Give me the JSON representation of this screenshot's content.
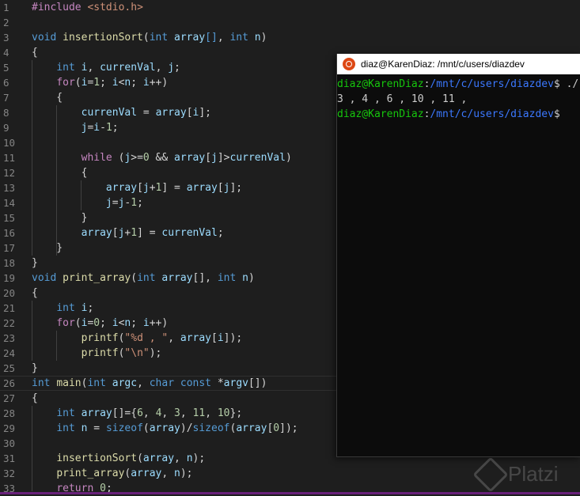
{
  "editor": {
    "lines": [
      {
        "n": "1",
        "segs": [
          [
            "pre",
            "#include"
          ],
          [
            "p",
            " "
          ],
          [
            "str",
            "<stdio.h>"
          ]
        ]
      },
      {
        "n": "2",
        "segs": []
      },
      {
        "n": "3",
        "segs": [
          [
            "kw",
            "void"
          ],
          [
            "p",
            " "
          ],
          [
            "fn",
            "insertionSort"
          ],
          [
            "p",
            "("
          ],
          [
            "kw",
            "int"
          ],
          [
            "p",
            " "
          ],
          [
            "var",
            "array"
          ],
          [
            "kw",
            "[]"
          ],
          [
            "p",
            ", "
          ],
          [
            "kw",
            "int"
          ],
          [
            "p",
            " "
          ],
          [
            "var",
            "n"
          ],
          [
            "p",
            ")"
          ]
        ]
      },
      {
        "n": "4",
        "segs": [
          [
            "p",
            "{"
          ]
        ]
      },
      {
        "n": "5",
        "segs": [
          [
            "p",
            "    "
          ],
          [
            "kw",
            "int"
          ],
          [
            "p",
            " "
          ],
          [
            "var",
            "i"
          ],
          [
            "p",
            ", "
          ],
          [
            "var",
            "currenVal"
          ],
          [
            "p",
            ", "
          ],
          [
            "var",
            "j"
          ],
          [
            "p",
            ";"
          ]
        ]
      },
      {
        "n": "6",
        "segs": [
          [
            "p",
            "    "
          ],
          [
            "ctl",
            "for"
          ],
          [
            "p",
            "("
          ],
          [
            "var",
            "i"
          ],
          [
            "p",
            "="
          ],
          [
            "num",
            "1"
          ],
          [
            "p",
            "; "
          ],
          [
            "var",
            "i"
          ],
          [
            "p",
            "<"
          ],
          [
            "var",
            "n"
          ],
          [
            "p",
            "; "
          ],
          [
            "var",
            "i"
          ],
          [
            "p",
            "++)"
          ]
        ]
      },
      {
        "n": "7",
        "segs": [
          [
            "p",
            "    {"
          ]
        ]
      },
      {
        "n": "8",
        "segs": [
          [
            "p",
            "        "
          ],
          [
            "var",
            "currenVal"
          ],
          [
            "p",
            " = "
          ],
          [
            "var",
            "array"
          ],
          [
            "p",
            "["
          ],
          [
            "var",
            "i"
          ],
          [
            "p",
            "];"
          ]
        ]
      },
      {
        "n": "9",
        "segs": [
          [
            "p",
            "        "
          ],
          [
            "var",
            "j"
          ],
          [
            "p",
            "="
          ],
          [
            "var",
            "i"
          ],
          [
            "p",
            "-"
          ],
          [
            "num",
            "1"
          ],
          [
            "p",
            ";"
          ]
        ]
      },
      {
        "n": "10",
        "segs": []
      },
      {
        "n": "11",
        "segs": [
          [
            "p",
            "        "
          ],
          [
            "ctl",
            "while"
          ],
          [
            "p",
            " ("
          ],
          [
            "var",
            "j"
          ],
          [
            "p",
            ">="
          ],
          [
            "num",
            "0"
          ],
          [
            "p",
            " && "
          ],
          [
            "var",
            "array"
          ],
          [
            "p",
            "["
          ],
          [
            "var",
            "j"
          ],
          [
            "p",
            "]>"
          ],
          [
            "var",
            "currenVal"
          ],
          [
            "p",
            ")"
          ]
        ]
      },
      {
        "n": "12",
        "segs": [
          [
            "p",
            "        {"
          ]
        ]
      },
      {
        "n": "13",
        "segs": [
          [
            "p",
            "            "
          ],
          [
            "var",
            "array"
          ],
          [
            "p",
            "["
          ],
          [
            "var",
            "j"
          ],
          [
            "p",
            "+"
          ],
          [
            "num",
            "1"
          ],
          [
            "p",
            "] = "
          ],
          [
            "var",
            "array"
          ],
          [
            "p",
            "["
          ],
          [
            "var",
            "j"
          ],
          [
            "p",
            "];"
          ]
        ]
      },
      {
        "n": "14",
        "segs": [
          [
            "p",
            "            "
          ],
          [
            "var",
            "j"
          ],
          [
            "p",
            "="
          ],
          [
            "var",
            "j"
          ],
          [
            "p",
            "-"
          ],
          [
            "num",
            "1"
          ],
          [
            "p",
            ";"
          ]
        ]
      },
      {
        "n": "15",
        "segs": [
          [
            "p",
            "        }"
          ]
        ]
      },
      {
        "n": "16",
        "segs": [
          [
            "p",
            "        "
          ],
          [
            "var",
            "array"
          ],
          [
            "p",
            "["
          ],
          [
            "var",
            "j"
          ],
          [
            "p",
            "+"
          ],
          [
            "num",
            "1"
          ],
          [
            "p",
            "] = "
          ],
          [
            "var",
            "currenVal"
          ],
          [
            "p",
            ";"
          ]
        ]
      },
      {
        "n": "17",
        "segs": [
          [
            "p",
            "    }"
          ]
        ]
      },
      {
        "n": "18",
        "segs": [
          [
            "p",
            "}"
          ]
        ]
      },
      {
        "n": "19",
        "segs": [
          [
            "kw",
            "void"
          ],
          [
            "p",
            " "
          ],
          [
            "fn",
            "print_array"
          ],
          [
            "p",
            "("
          ],
          [
            "kw",
            "int"
          ],
          [
            "p",
            " "
          ],
          [
            "var",
            "array"
          ],
          [
            "p",
            "[], "
          ],
          [
            "kw",
            "int"
          ],
          [
            "p",
            " "
          ],
          [
            "var",
            "n"
          ],
          [
            "p",
            ")"
          ]
        ]
      },
      {
        "n": "20",
        "segs": [
          [
            "p",
            "{"
          ]
        ]
      },
      {
        "n": "21",
        "segs": [
          [
            "p",
            "    "
          ],
          [
            "kw",
            "int"
          ],
          [
            "p",
            " "
          ],
          [
            "var",
            "i"
          ],
          [
            "p",
            ";"
          ]
        ]
      },
      {
        "n": "22",
        "segs": [
          [
            "p",
            "    "
          ],
          [
            "ctl",
            "for"
          ],
          [
            "p",
            "("
          ],
          [
            "var",
            "i"
          ],
          [
            "p",
            "="
          ],
          [
            "num",
            "0"
          ],
          [
            "p",
            "; "
          ],
          [
            "var",
            "i"
          ],
          [
            "p",
            "<"
          ],
          [
            "var",
            "n"
          ],
          [
            "p",
            "; "
          ],
          [
            "var",
            "i"
          ],
          [
            "p",
            "++)"
          ]
        ]
      },
      {
        "n": "23",
        "segs": [
          [
            "p",
            "        "
          ],
          [
            "fn",
            "printf"
          ],
          [
            "p",
            "("
          ],
          [
            "str",
            "\"%d , \""
          ],
          [
            "p",
            ", "
          ],
          [
            "var",
            "array"
          ],
          [
            "p",
            "["
          ],
          [
            "var",
            "i"
          ],
          [
            "p",
            "]);"
          ]
        ]
      },
      {
        "n": "24",
        "segs": [
          [
            "p",
            "        "
          ],
          [
            "fn",
            "printf"
          ],
          [
            "p",
            "("
          ],
          [
            "str",
            "\"\\n\""
          ],
          [
            "p",
            ");"
          ]
        ]
      },
      {
        "n": "25",
        "segs": [
          [
            "p",
            "}"
          ]
        ]
      },
      {
        "n": "26",
        "segs": [
          [
            "kw",
            "int"
          ],
          [
            "p",
            " "
          ],
          [
            "fn",
            "main"
          ],
          [
            "p",
            "("
          ],
          [
            "kw",
            "int"
          ],
          [
            "p",
            " "
          ],
          [
            "var",
            "argc"
          ],
          [
            "p",
            ", "
          ],
          [
            "kw",
            "char"
          ],
          [
            "p",
            " "
          ],
          [
            "kw",
            "const"
          ],
          [
            "p",
            " *"
          ],
          [
            "var",
            "argv"
          ],
          [
            "p",
            "[])"
          ]
        ]
      },
      {
        "n": "27",
        "segs": [
          [
            "p",
            "{"
          ]
        ]
      },
      {
        "n": "28",
        "segs": [
          [
            "p",
            "    "
          ],
          [
            "kw",
            "int"
          ],
          [
            "p",
            " "
          ],
          [
            "var",
            "array"
          ],
          [
            "p",
            "[]={"
          ],
          [
            "num",
            "6"
          ],
          [
            "p",
            ", "
          ],
          [
            "num",
            "4"
          ],
          [
            "p",
            ", "
          ],
          [
            "num",
            "3"
          ],
          [
            "p",
            ", "
          ],
          [
            "num",
            "11"
          ],
          [
            "p",
            ", "
          ],
          [
            "num",
            "10"
          ],
          [
            "p",
            "};"
          ]
        ]
      },
      {
        "n": "29",
        "segs": [
          [
            "p",
            "    "
          ],
          [
            "kw",
            "int"
          ],
          [
            "p",
            " "
          ],
          [
            "var",
            "n"
          ],
          [
            "p",
            " = "
          ],
          [
            "kw",
            "sizeof"
          ],
          [
            "p",
            "("
          ],
          [
            "var",
            "array"
          ],
          [
            "p",
            ")/"
          ],
          [
            "kw",
            "sizeof"
          ],
          [
            "p",
            "("
          ],
          [
            "var",
            "array"
          ],
          [
            "p",
            "["
          ],
          [
            "num",
            "0"
          ],
          [
            "p",
            "]);"
          ]
        ]
      },
      {
        "n": "30",
        "segs": []
      },
      {
        "n": "31",
        "segs": [
          [
            "p",
            "    "
          ],
          [
            "fn",
            "insertionSort"
          ],
          [
            "p",
            "("
          ],
          [
            "var",
            "array"
          ],
          [
            "p",
            ", "
          ],
          [
            "var",
            "n"
          ],
          [
            "p",
            ");"
          ]
        ]
      },
      {
        "n": "32",
        "segs": [
          [
            "p",
            "    "
          ],
          [
            "fn",
            "print_array"
          ],
          [
            "p",
            "("
          ],
          [
            "var",
            "array"
          ],
          [
            "p",
            ", "
          ],
          [
            "var",
            "n"
          ],
          [
            "p",
            ");"
          ]
        ]
      },
      {
        "n": "33",
        "segs": [
          [
            "p",
            "    "
          ],
          [
            "ctl",
            "return"
          ],
          [
            "p",
            " "
          ],
          [
            "num",
            "0"
          ],
          [
            "p",
            ";"
          ]
        ]
      }
    ]
  },
  "terminal": {
    "title": "diaz@KarenDiaz: /mnt/c/users/diazdev",
    "lines": [
      {
        "segs": [
          [
            "tuser",
            "diaz@KarenDiaz"
          ],
          [
            "p",
            ":"
          ],
          [
            "tpath",
            "/mnt/c/users/diazdev"
          ],
          [
            "p",
            "$ ./"
          ]
        ]
      },
      {
        "segs": [
          [
            "p",
            "3 , 4 , 6 , 10 , 11 ,"
          ]
        ]
      },
      {
        "segs": [
          [
            "tuser",
            "diaz@KarenDiaz"
          ],
          [
            "p",
            ":"
          ],
          [
            "tpath",
            "/mnt/c/users/diazdev"
          ],
          [
            "p",
            "$"
          ]
        ]
      }
    ]
  },
  "watermark": {
    "text": "Platzi"
  },
  "colors": {
    "editor_bg": "#1e1e1e",
    "keyword": "#569cd6",
    "function": "#dcdcaa",
    "variable": "#9cdcfe",
    "string": "#ce9178",
    "number": "#b5cea8",
    "terminal_user": "#16c60c",
    "terminal_path": "#3b78ff"
  }
}
